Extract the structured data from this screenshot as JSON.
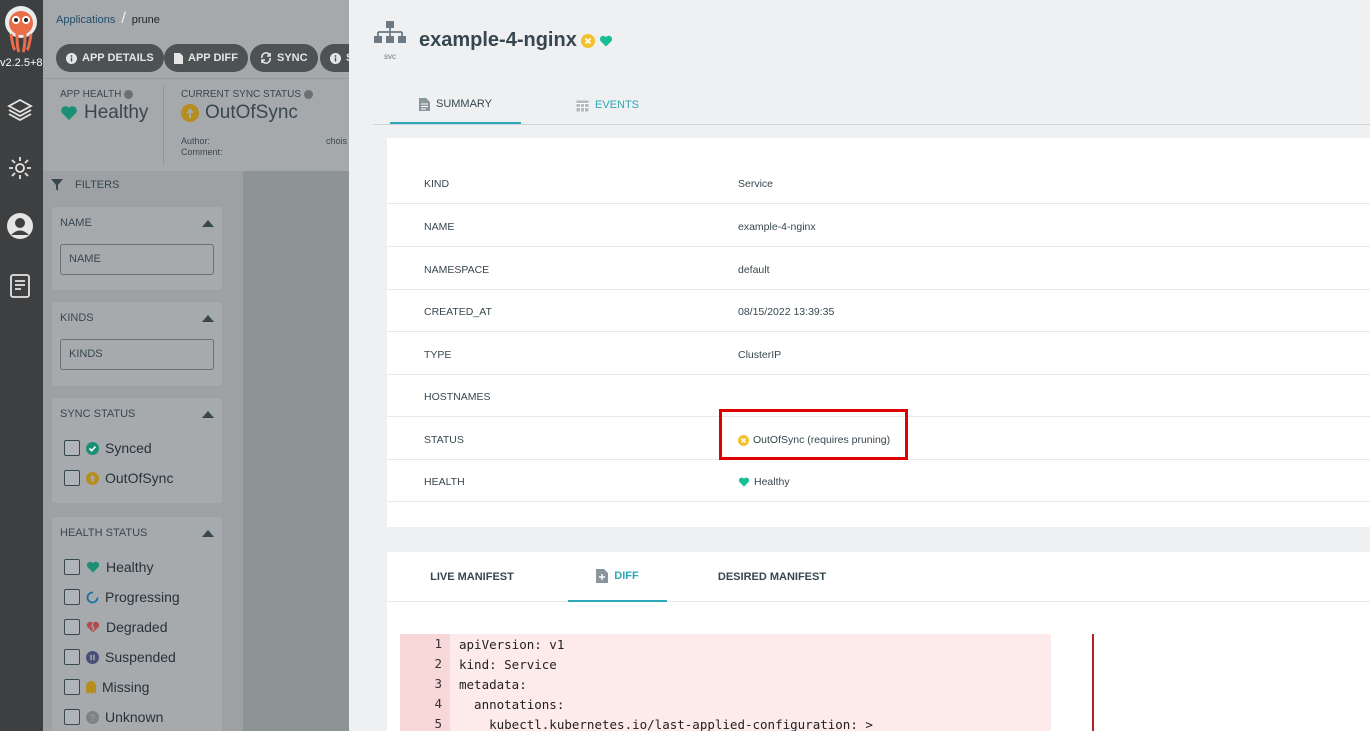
{
  "nav": {
    "version": "v2.2.5+8",
    "icons": [
      "argo-logo-icon",
      "layers-icon",
      "settings-gear-icon",
      "user-icon",
      "docs-icon"
    ]
  },
  "breadcrumb": {
    "root": "Applications",
    "current": "prune"
  },
  "actions": [
    {
      "label": "APP DETAILS",
      "icon": "info-icon"
    },
    {
      "label": "APP DIFF",
      "icon": "file-icon"
    },
    {
      "label": "SYNC",
      "icon": "sync-icon"
    },
    {
      "label": "S",
      "icon": "info-icon"
    }
  ],
  "app_status": {
    "health_label": "APP HEALTH",
    "health_value": "Healthy",
    "sync_label": "CURRENT SYNC STATUS",
    "sync_value": "OutOfSync",
    "author_label": "Author:",
    "author_value": "chois",
    "comment_label": "Comment:"
  },
  "filters": {
    "title": "FILTERS",
    "name_section": {
      "title": "NAME",
      "placeholder": "NAME"
    },
    "kinds_section": {
      "title": "KINDS",
      "placeholder": "KINDS"
    },
    "sync_section": {
      "title": "SYNC STATUS",
      "options": [
        "Synced",
        "OutOfSync"
      ]
    },
    "health_section": {
      "title": "HEALTH STATUS",
      "options": [
        "Healthy",
        "Progressing",
        "Degraded",
        "Suspended",
        "Missing",
        "Unknown"
      ]
    }
  },
  "panel": {
    "icon_caption": "svc",
    "title": "example-4-nginx",
    "tabs": {
      "summary": "SUMMARY",
      "events": "EVENTS"
    },
    "summary": [
      {
        "key": "KIND",
        "value": "Service"
      },
      {
        "key": "NAME",
        "value": "example-4-nginx"
      },
      {
        "key": "NAMESPACE",
        "value": "default"
      },
      {
        "key": "CREATED_AT",
        "value": "08/15/2022 13:39:35"
      },
      {
        "key": "TYPE",
        "value": "ClusterIP"
      },
      {
        "key": "HOSTNAMES",
        "value": ""
      },
      {
        "key": "STATUS",
        "value": "OutOfSync (requires pruning)"
      },
      {
        "key": "HEALTH",
        "value": "Healthy"
      }
    ],
    "manifest_tabs": {
      "live": "LIVE MANIFEST",
      "diff": "DIFF",
      "desired": "DESIRED MANIFEST"
    },
    "code_lines": [
      {
        "n": "1",
        "text": "apiVersion: v1"
      },
      {
        "n": "2",
        "text": "kind: Service"
      },
      {
        "n": "3",
        "text": "metadata:"
      },
      {
        "n": "4",
        "text": "  annotations:"
      },
      {
        "n": "5",
        "text": "    kubectl.kubernetes.io/last-applied-configuration: >"
      }
    ]
  },
  "colors": {
    "accent": "#2ca8b7",
    "healthy": "#18be94",
    "out_of_sync": "#f4c030",
    "highlight": "#e00000"
  }
}
